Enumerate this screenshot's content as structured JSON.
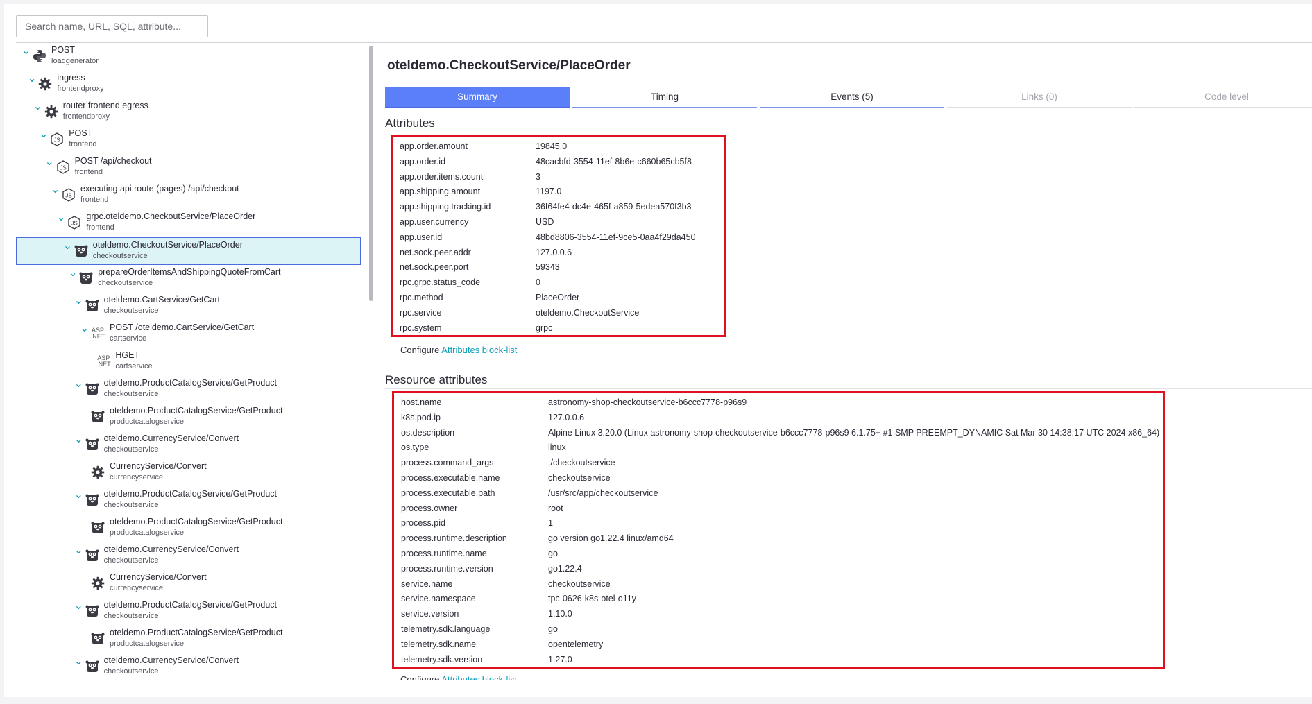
{
  "search": {
    "placeholder": "Search name, URL, SQL, attribute..."
  },
  "tree": [
    {
      "name": "POST",
      "service": "loadgenerator",
      "icon": "python-icon",
      "expanded": true,
      "depth": 0,
      "selected": false
    },
    {
      "name": "ingress",
      "service": "frontendproxy",
      "icon": "gear-icon",
      "expanded": true,
      "depth": 1,
      "selected": false
    },
    {
      "name": "router frontend egress",
      "service": "frontendproxy",
      "icon": "gear-icon",
      "expanded": true,
      "depth": 2,
      "selected": false
    },
    {
      "name": "POST",
      "service": "frontend",
      "icon": "nodejs-icon",
      "expanded": true,
      "depth": 3,
      "selected": false
    },
    {
      "name": "POST /api/checkout",
      "service": "frontend",
      "icon": "nodejs-icon",
      "expanded": true,
      "depth": 4,
      "selected": false
    },
    {
      "name": "executing api route (pages) /api/checkout",
      "service": "frontend",
      "icon": "nodejs-icon",
      "expanded": true,
      "depth": 5,
      "selected": false
    },
    {
      "name": "grpc.oteldemo.CheckoutService/PlaceOrder",
      "service": "frontend",
      "icon": "nodejs-icon",
      "expanded": true,
      "depth": 6,
      "selected": false
    },
    {
      "name": "oteldemo.CheckoutService/PlaceOrder",
      "service": "checkoutservice",
      "icon": "go-gopher-icon",
      "expanded": true,
      "depth": 7,
      "selected": true
    },
    {
      "name": "prepareOrderItemsAndShippingQuoteFromCart",
      "service": "checkoutservice",
      "icon": "go-gopher-icon",
      "expanded": true,
      "depth": 8,
      "selected": false
    },
    {
      "name": "oteldemo.CartService/GetCart",
      "service": "checkoutservice",
      "icon": "go-gopher-icon",
      "expanded": true,
      "depth": 9,
      "selected": false
    },
    {
      "name": "POST /oteldemo.CartService/GetCart",
      "service": "cartservice",
      "icon": "aspnet-icon",
      "expanded": true,
      "depth": 10,
      "selected": false
    },
    {
      "name": "HGET",
      "service": "cartservice",
      "icon": "aspnet-icon",
      "expanded": false,
      "depth": 11,
      "selected": false
    },
    {
      "name": "oteldemo.ProductCatalogService/GetProduct",
      "service": "checkoutservice",
      "icon": "go-gopher-icon",
      "expanded": true,
      "depth": 9,
      "selected": false
    },
    {
      "name": "oteldemo.ProductCatalogService/GetProduct",
      "service": "productcatalogservice",
      "icon": "go-gopher-icon",
      "expanded": false,
      "depth": 10,
      "selected": false
    },
    {
      "name": "oteldemo.CurrencyService/Convert",
      "service": "checkoutservice",
      "icon": "go-gopher-icon",
      "expanded": true,
      "depth": 9,
      "selected": false
    },
    {
      "name": "CurrencyService/Convert",
      "service": "currencyservice",
      "icon": "gear-icon",
      "expanded": false,
      "depth": 10,
      "selected": false
    },
    {
      "name": "oteldemo.ProductCatalogService/GetProduct",
      "service": "checkoutservice",
      "icon": "go-gopher-icon",
      "expanded": true,
      "depth": 9,
      "selected": false
    },
    {
      "name": "oteldemo.ProductCatalogService/GetProduct",
      "service": "productcatalogservice",
      "icon": "go-gopher-icon",
      "expanded": false,
      "depth": 10,
      "selected": false
    },
    {
      "name": "oteldemo.CurrencyService/Convert",
      "service": "checkoutservice",
      "icon": "go-gopher-icon",
      "expanded": true,
      "depth": 9,
      "selected": false
    },
    {
      "name": "CurrencyService/Convert",
      "service": "currencyservice",
      "icon": "gear-icon",
      "expanded": false,
      "depth": 10,
      "selected": false
    },
    {
      "name": "oteldemo.ProductCatalogService/GetProduct",
      "service": "checkoutservice",
      "icon": "go-gopher-icon",
      "expanded": true,
      "depth": 9,
      "selected": false
    },
    {
      "name": "oteldemo.ProductCatalogService/GetProduct",
      "service": "productcatalogservice",
      "icon": "go-gopher-icon",
      "expanded": false,
      "depth": 10,
      "selected": false
    },
    {
      "name": "oteldemo.CurrencyService/Convert",
      "service": "checkoutservice",
      "icon": "go-gopher-icon",
      "expanded": true,
      "depth": 9,
      "selected": false
    }
  ],
  "detail": {
    "title": "oteldemo.CheckoutService/PlaceOrder",
    "tabs": [
      {
        "label": "Summary",
        "state": "active"
      },
      {
        "label": "Timing",
        "state": "normal"
      },
      {
        "label": "Events (5)",
        "state": "normal"
      },
      {
        "label": "Links (0)",
        "state": "disabled"
      },
      {
        "label": "Code level",
        "state": "disabled"
      }
    ],
    "attributes_title": "Attributes",
    "attributes": [
      [
        "app.order.amount",
        "19845.0"
      ],
      [
        "app.order.id",
        "48cacbfd-3554-11ef-8b6e-c660b65cb5f8"
      ],
      [
        "app.order.items.count",
        "3"
      ],
      [
        "app.shipping.amount",
        "1197.0"
      ],
      [
        "app.shipping.tracking.id",
        "36f64fe4-dc4e-465f-a859-5edea570f3b3"
      ],
      [
        "app.user.currency",
        "USD"
      ],
      [
        "app.user.id",
        "48bd8806-3554-11ef-9ce5-0aa4f29da450"
      ],
      [
        "net.sock.peer.addr",
        "127.0.0.6"
      ],
      [
        "net.sock.peer.port",
        "59343"
      ],
      [
        "rpc.grpc.status_code",
        "0"
      ],
      [
        "rpc.method",
        "PlaceOrder"
      ],
      [
        "rpc.service",
        "oteldemo.CheckoutService"
      ],
      [
        "rpc.system",
        "grpc"
      ]
    ],
    "configure_label": "Configure",
    "blocklist_link": "Attributes block-list",
    "resource_title": "Resource attributes",
    "resource_attributes": [
      [
        "host.name",
        "astronomy-shop-checkoutservice-b6ccc7778-p96s9"
      ],
      [
        "k8s.pod.ip",
        "127.0.0.6"
      ],
      [
        "os.description",
        "Alpine Linux 3.20.0 (Linux astronomy-shop-checkoutservice-b6ccc7778-p96s9 6.1.75+ #1 SMP PREEMPT_DYNAMIC Sat Mar 30 14:38:17 UTC 2024 x86_64)"
      ],
      [
        "os.type",
        "linux"
      ],
      [
        "process.command_args",
        "./checkoutservice"
      ],
      [
        "process.executable.name",
        "checkoutservice"
      ],
      [
        "process.executable.path",
        "/usr/src/app/checkoutservice"
      ],
      [
        "process.owner",
        "root"
      ],
      [
        "process.pid",
        "1"
      ],
      [
        "process.runtime.description",
        "go version go1.22.4 linux/amd64"
      ],
      [
        "process.runtime.name",
        "go"
      ],
      [
        "process.runtime.version",
        "go1.22.4"
      ],
      [
        "service.name",
        "checkoutservice"
      ],
      [
        "service.namespace",
        "tpc-0626-k8s-otel-o11y"
      ],
      [
        "service.version",
        "1.10.0"
      ],
      [
        "telemetry.sdk.language",
        "go"
      ],
      [
        "telemetry.sdk.name",
        "opentelemetry"
      ],
      [
        "telemetry.sdk.version",
        "1.27.0"
      ]
    ]
  },
  "colors": {
    "accent": "#5b7ff9",
    "link": "#0d9eb8",
    "highlight_box": "#e0101e",
    "selected_bg": "#dcf4f6"
  }
}
